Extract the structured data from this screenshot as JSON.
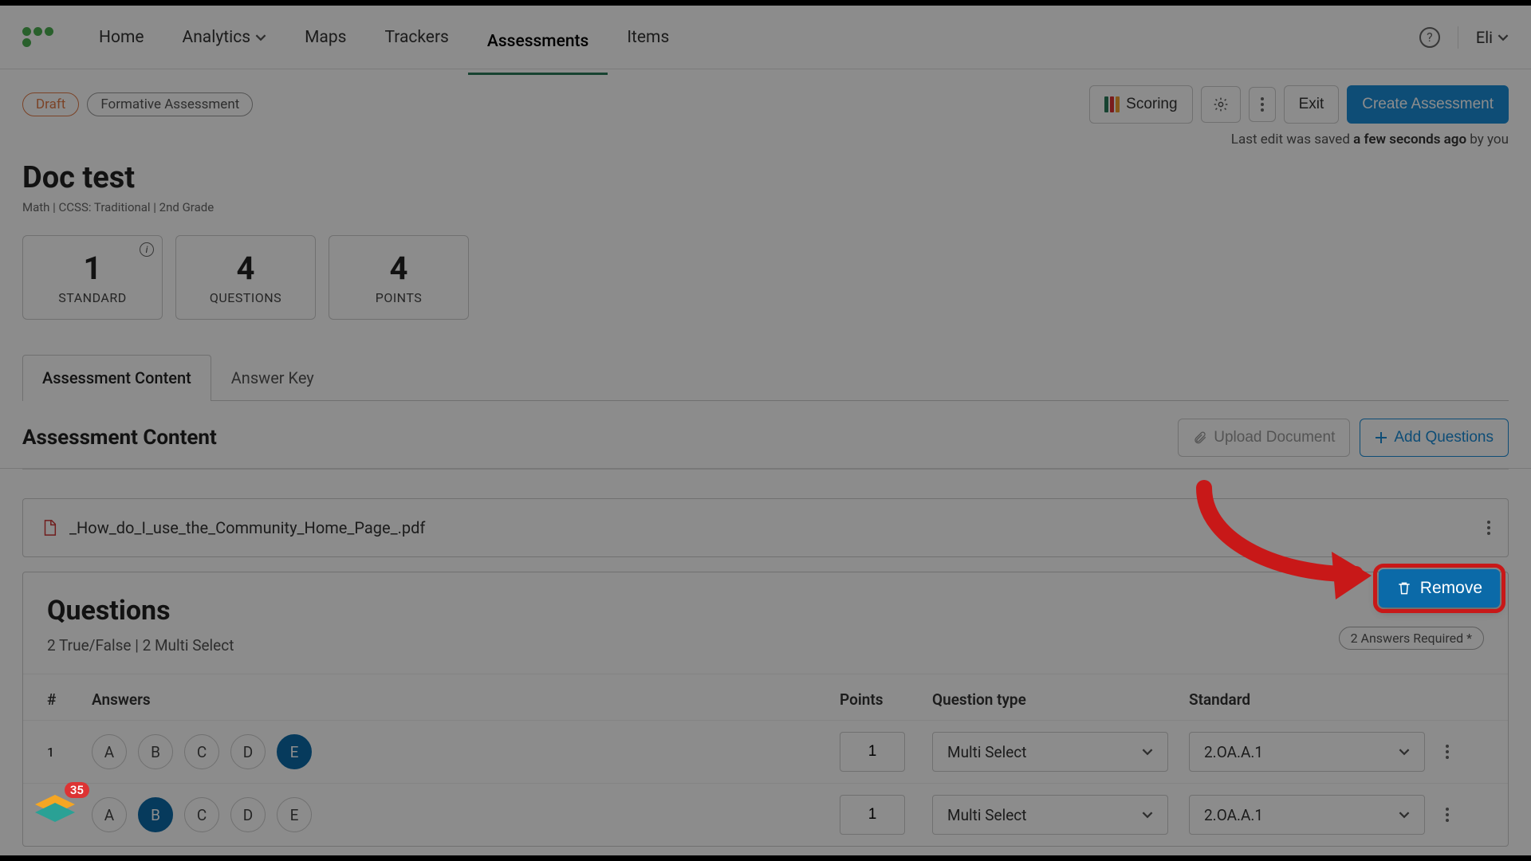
{
  "nav": {
    "items": [
      "Home",
      "Analytics",
      "Maps",
      "Trackers",
      "Assessments",
      "Items"
    ],
    "active_index": 4,
    "user": "Eli"
  },
  "toolbar": {
    "draft_label": "Draft",
    "type_label": "Formative Assessment",
    "scoring_label": "Scoring",
    "exit_label": "Exit",
    "create_label": "Create Assessment"
  },
  "save_status": {
    "prefix": "Last edit was saved ",
    "time": "a few seconds ago",
    "suffix": " by you"
  },
  "page": {
    "title": "Doc test",
    "meta": "Math  |  CCSS: Traditional  |  2nd Grade"
  },
  "stats": [
    {
      "value": "1",
      "label": "STANDARD",
      "info": true
    },
    {
      "value": "4",
      "label": "QUESTIONS",
      "info": false
    },
    {
      "value": "4",
      "label": "POINTS",
      "info": false
    }
  ],
  "tabs": {
    "items": [
      "Assessment Content",
      "Answer Key"
    ],
    "active_index": 0
  },
  "section": {
    "heading": "Assessment Content",
    "upload_label": "Upload Document",
    "add_label": "Add Questions"
  },
  "file": {
    "name": "_How_do_I_use_the_Community_Home_Page_.pdf"
  },
  "questions": {
    "heading": "Questions",
    "subtitle": "2 True/False | 2 Multi Select",
    "required_pill": "2 Answers Required *",
    "columns": {
      "num": "#",
      "answers": "Answers",
      "points": "Points",
      "type": "Question type",
      "standard": "Standard"
    },
    "rows": [
      {
        "num": "1",
        "options": [
          "A",
          "B",
          "C",
          "D",
          "E"
        ],
        "selected": [
          "E"
        ],
        "points": "1",
        "type": "Multi Select",
        "standard": "2.OA.A.1"
      },
      {
        "num": "",
        "options": [
          "A",
          "B",
          "C",
          "D",
          "E"
        ],
        "selected": [
          "B"
        ],
        "points": "1",
        "type": "Multi Select",
        "standard": "2.OA.A.1"
      }
    ]
  },
  "popup": {
    "remove_label": "Remove"
  },
  "widget": {
    "count": "35"
  }
}
